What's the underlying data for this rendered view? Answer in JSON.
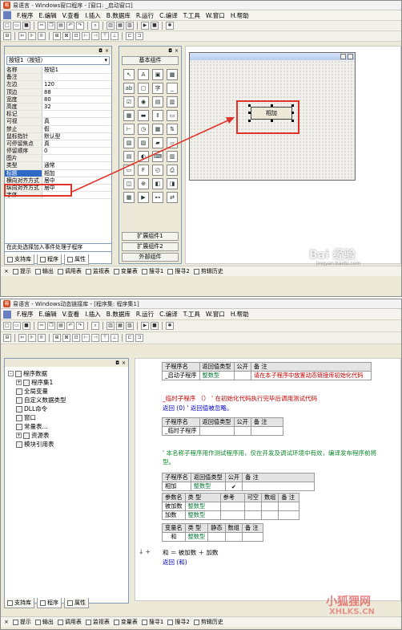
{
  "window1": {
    "title": "易语言 - Windows窗口程序 - [窗口: _启动窗口]",
    "menu": [
      "F.程序",
      "E.编辑",
      "V.查看",
      "I.插入",
      "B.数据库",
      "R.运行",
      "C.编译",
      "T.工具",
      "W.窗口",
      "H.帮助"
    ],
    "property_combo": "按钮1（按钮）",
    "properties": [
      {
        "name": "名称",
        "value": "按钮1"
      },
      {
        "name": "备注",
        "value": ""
      },
      {
        "name": "左边",
        "value": "120"
      },
      {
        "name": "顶边",
        "value": "88"
      },
      {
        "name": "宽度",
        "value": "80"
      },
      {
        "name": "高度",
        "value": "32"
      },
      {
        "name": "标记",
        "value": ""
      },
      {
        "name": "可视",
        "value": "真"
      },
      {
        "name": "禁止",
        "value": "假"
      },
      {
        "name": "鼠标指针",
        "value": "默认型"
      },
      {
        "name": "可停留焦点",
        "value": "真"
      },
      {
        "name": "停留顺序",
        "value": "0"
      },
      {
        "name": "图片",
        "value": ""
      },
      {
        "name": "类型",
        "value": "通常"
      },
      {
        "name": "标题",
        "value": "相加"
      },
      {
        "name": "横向对齐方式",
        "value": "居中"
      },
      {
        "name": "纵向对齐方式",
        "value": "居中"
      },
      {
        "name": "字体",
        "value": ""
      }
    ],
    "event_select": "在此处选择加入事件处理子程序",
    "left_tabs": [
      "支持库",
      "程序",
      "属性"
    ],
    "components_header": "基本组件",
    "component_groups": [
      "扩展组件1",
      "扩展组件2",
      "外部组件"
    ],
    "button_caption": "相加",
    "watermark_brand": "Bai 经验",
    "watermark_url": "jingyan.baidu.com"
  },
  "statusbar": [
    "提示",
    "输出",
    "调用表",
    "监视表",
    "变量表",
    "搜寻1",
    "搜寻2",
    "剪辑历史"
  ],
  "window2": {
    "title": "易语言 - Windows动态链接库 - [程序集: 程序集1]",
    "menu": [
      "F.程序",
      "E.编辑",
      "V.查看",
      "I.插入",
      "B.数据库",
      "R.运行",
      "C.编译",
      "T.工具",
      "W.窗口",
      "H.帮助"
    ],
    "tree": [
      {
        "label": "程序数据",
        "indent": 0,
        "box": "-"
      },
      {
        "label": "程序集1",
        "indent": 1,
        "box": "+"
      },
      {
        "label": "全局变量",
        "indent": 1,
        "box": ""
      },
      {
        "label": "自定义数据类型",
        "indent": 1,
        "box": ""
      },
      {
        "label": "DLL命令",
        "indent": 1,
        "box": ""
      },
      {
        "label": "窗口",
        "indent": 1,
        "box": ""
      },
      {
        "label": "常量表...",
        "indent": 1,
        "box": ""
      },
      {
        "label": "资源表",
        "indent": 1,
        "box": "+"
      },
      {
        "label": "模块引用表",
        "indent": 1,
        "box": ""
      }
    ],
    "left_tabs": [
      "支持库",
      "程序",
      "属性"
    ],
    "sub1_header": [
      "子程序名",
      "返回值类型",
      "公开",
      "备 注"
    ],
    "sub1_row": [
      "_启动子程序",
      "整数型",
      "",
      "请在本子程序中放置动态链接库初始化代码"
    ],
    "temp_line1": "_临时子程序 （）  ' 在初始化代码执行完毕后调用测试代码",
    "temp_line2": "返回 (0)  ' 返回值被忽略。",
    "sub2_header": [
      "子程序名",
      "返回值类型",
      "公开",
      "备 注"
    ],
    "sub2_row": "_临时子程序",
    "comment_line1": "' 本名称子程序用作测试程序用，仅在开发及调试环境中有效，编译发布程序前将",
    "comment_line2": "型。",
    "sub3_header": [
      "子程序名",
      "返回值类型",
      "公开",
      "备 注"
    ],
    "sub3_row": [
      "相加",
      "整数型",
      "✔",
      ""
    ],
    "param_header": [
      "参数名",
      "类 型",
      "参考",
      "可空",
      "数组",
      "备 注"
    ],
    "params": [
      [
        "被加数",
        "整数型"
      ],
      [
        "加数",
        "整数型"
      ]
    ],
    "var_header": [
      "变量名",
      "类 型",
      "静态",
      "数组",
      "备 注"
    ],
    "var_row": [
      "和",
      "整数型"
    ],
    "code1": "和 ＝ 被加数 ＋ 加数",
    "code2": "返回 (和)",
    "watermark_site": "小狐狸网",
    "watermark_url": "XHLKS.CN"
  }
}
